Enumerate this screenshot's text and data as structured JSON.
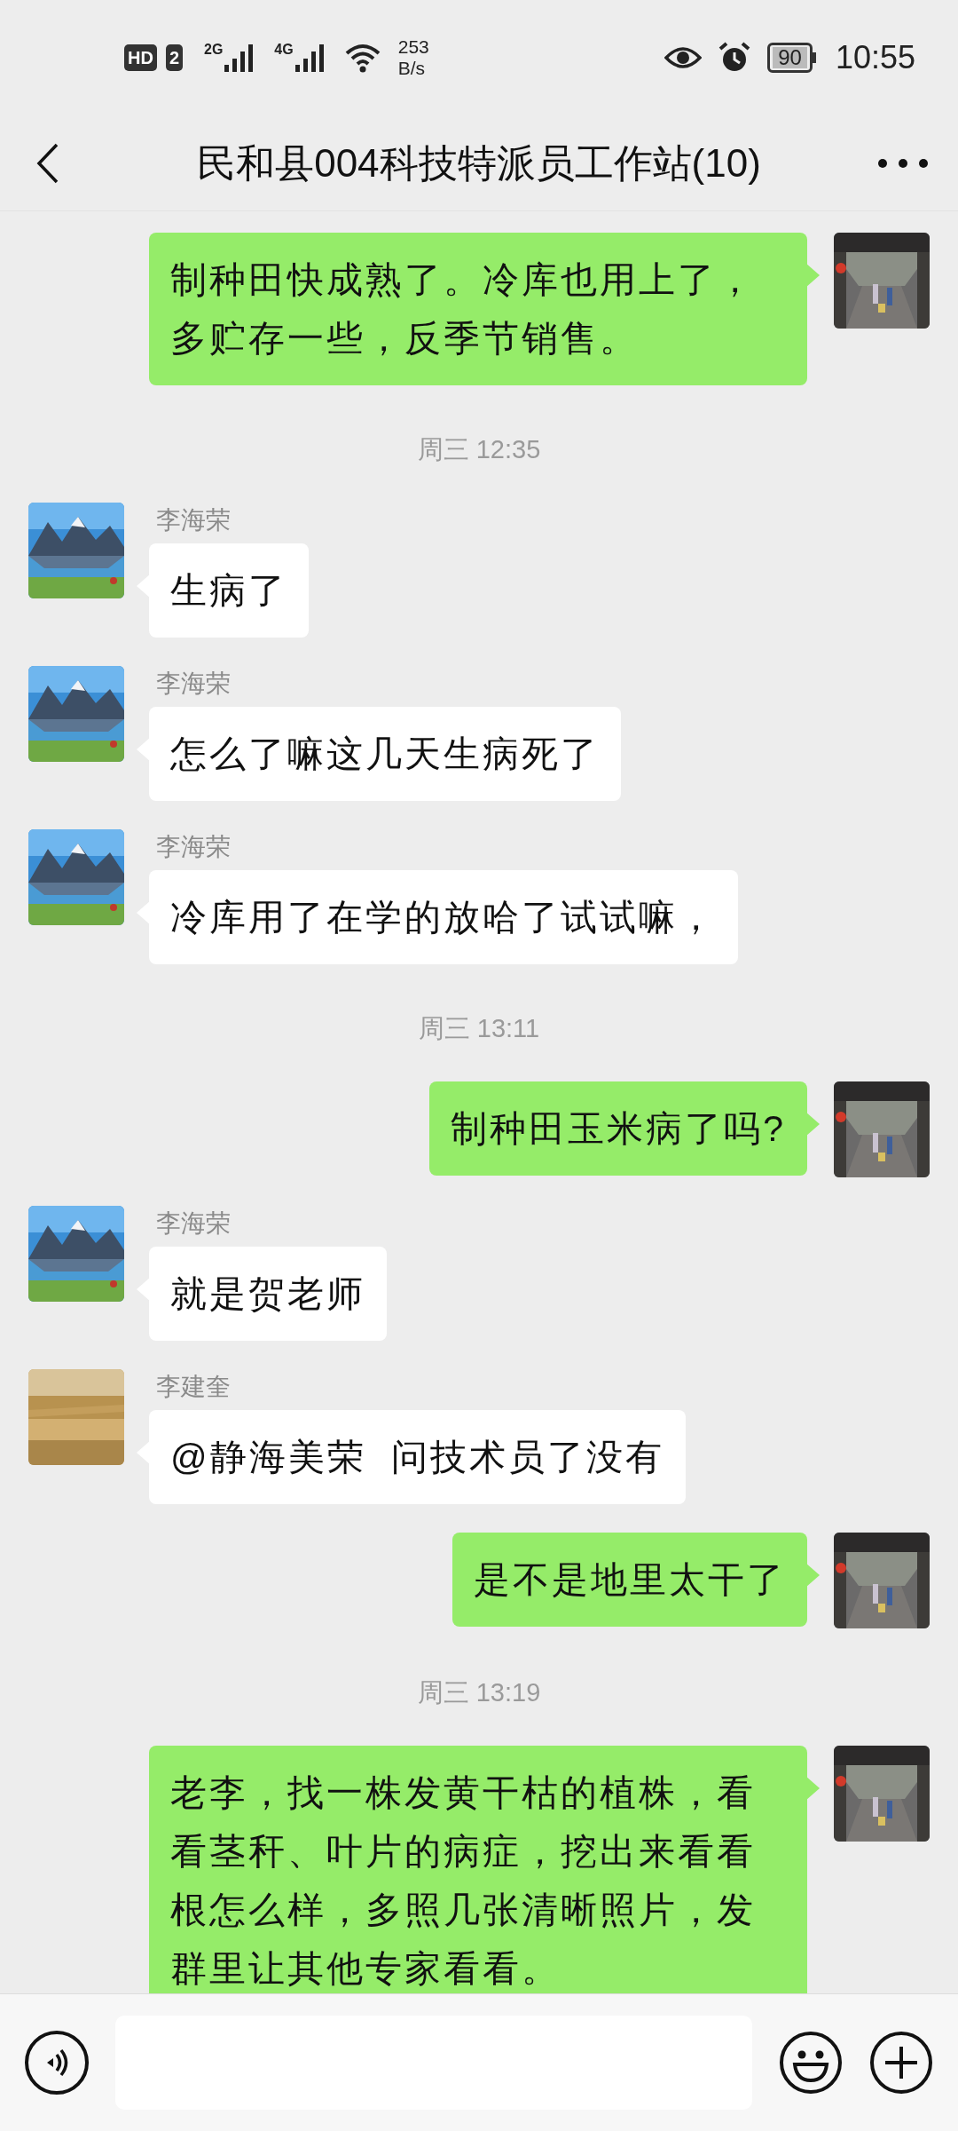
{
  "status_bar": {
    "hd": "HD",
    "sim": "2",
    "net_1": "2G",
    "net_2": "4G",
    "speed_value": "253",
    "speed_unit": "B/s",
    "battery": "90",
    "time": "10:55"
  },
  "header": {
    "title": "民和县004科技特派员工作站(10)"
  },
  "messages": [
    {
      "kind": "self",
      "text": "制种田快成熟了。冷库也用上了，多贮存一些，反季节销售。"
    },
    {
      "kind": "time",
      "text": "周三 12:35"
    },
    {
      "kind": "other",
      "sender": "李海荣",
      "text": "生病了"
    },
    {
      "kind": "other",
      "sender": "李海荣",
      "text": "怎么了嘛这几天生病死了"
    },
    {
      "kind": "other",
      "sender": "李海荣",
      "text": "冷库用了在学的放哈了试试嘛，"
    },
    {
      "kind": "time",
      "text": "周三 13:11"
    },
    {
      "kind": "self",
      "text": "制种田玉米病了吗?"
    },
    {
      "kind": "other",
      "sender": "李海荣",
      "text": "就是贺老师"
    },
    {
      "kind": "other",
      "sender": "李建奎",
      "text": "@静海美荣  问技术员了没有"
    },
    {
      "kind": "self",
      "text": "是不是地里太干了"
    },
    {
      "kind": "time",
      "text": "周三 13:19"
    },
    {
      "kind": "self",
      "text": "老李，找一株发黄干枯的植株，看看茎秆、叶片的病症，挖出来看看根怎么样，多照几张清晰照片，发群里让其他专家看看。"
    }
  ]
}
